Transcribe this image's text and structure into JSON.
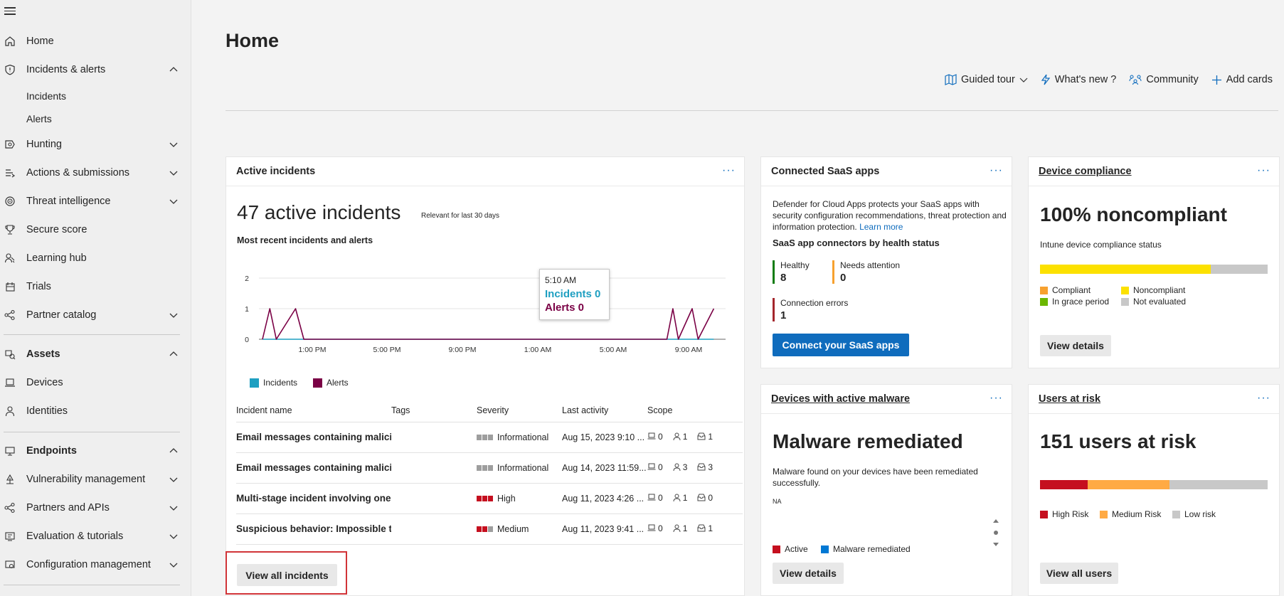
{
  "nav": {
    "home": "Home",
    "incidents_alerts": "Incidents & alerts",
    "incidents": "Incidents",
    "alerts": "Alerts",
    "hunting": "Hunting",
    "actions": "Actions & submissions",
    "threat_intel": "Threat intelligence",
    "secure_score": "Secure score",
    "learning_hub": "Learning hub",
    "trials": "Trials",
    "partner_catalog": "Partner catalog",
    "assets": "Assets",
    "devices": "Devices",
    "identities": "Identities",
    "endpoints": "Endpoints",
    "vuln_mgmt": "Vulnerability management",
    "partners_apis": "Partners and APIs",
    "eval_tutorials": "Evaluation & tutorials",
    "config_mgmt": "Configuration management"
  },
  "page": {
    "title": "Home"
  },
  "header_actions": {
    "guided_tour": "Guided tour",
    "whats_new": "What's new ?",
    "community": "Community",
    "add_cards": "Add cards"
  },
  "active_incidents": {
    "title": "Active incidents",
    "more": "···",
    "count_text": "47 active incidents",
    "relevant": "Relevant for last 30 days",
    "chart_title": "Most recent incidents and alerts",
    "tooltip": {
      "time": "5:10 AM",
      "incidents": "Incidents 0",
      "alerts": "Alerts 0"
    },
    "legend_incidents": "Incidents",
    "legend_alerts": "Alerts",
    "columns": [
      "Incident name",
      "Tags",
      "Severity",
      "Last activity",
      "Scope"
    ],
    "rows": [
      {
        "name": "Email messages containing malicio",
        "severity": "Informational",
        "last_activity": "Aug 15, 2023 9:10 ...",
        "devices": "0",
        "users": "1",
        "mailboxes": "1"
      },
      {
        "name": "Email messages containing malicio",
        "severity": "Informational",
        "last_activity": "Aug 14, 2023 11:59...",
        "devices": "0",
        "users": "3",
        "mailboxes": "3"
      },
      {
        "name": "Multi-stage incident involving one",
        "severity": "High",
        "last_activity": "Aug 11, 2023 4:26 ...",
        "devices": "0",
        "users": "1",
        "mailboxes": "0"
      },
      {
        "name": "Suspicious behavior: Impossible tr",
        "severity": "Medium",
        "last_activity": "Aug 11, 2023 9:41 ...",
        "devices": "0",
        "users": "1",
        "mailboxes": "1"
      }
    ],
    "view_all": "View all incidents"
  },
  "chart_data": {
    "type": "line",
    "title": "Most recent incidents and alerts",
    "x_tick_labels": [
      "1:00 PM",
      "5:00 PM",
      "9:00 PM",
      "1:00 AM",
      "5:00 AM",
      "9:00 AM"
    ],
    "y_ticks": [
      0,
      1,
      2
    ],
    "ylim": [
      0,
      2
    ],
    "series": [
      {
        "name": "Incidents",
        "color": "#1e9fc1",
        "values": [
          0,
          0,
          0,
          0,
          0,
          0,
          0,
          0,
          0,
          0,
          0,
          0,
          0,
          0,
          0,
          0,
          0,
          0,
          0,
          0,
          0,
          0,
          0,
          0,
          0,
          0
        ]
      },
      {
        "name": "Alerts",
        "color": "#7a0045",
        "values": [
          0,
          1,
          0,
          1,
          0,
          0,
          0,
          0,
          0,
          0,
          0,
          0,
          0,
          0,
          0,
          0,
          0,
          0,
          0,
          0,
          0,
          1,
          0,
          1,
          0,
          1
        ]
      }
    ],
    "x_positions_frac": [
      0.0,
      0.016,
      0.03,
      0.072,
      0.09,
      0.2,
      0.3,
      0.4,
      0.5,
      0.6,
      0.65,
      0.7,
      0.75,
      0.78,
      0.8,
      0.82,
      0.84,
      0.86,
      0.87,
      0.875,
      0.88,
      0.893,
      0.905,
      0.935,
      0.948,
      0.982
    ],
    "legend": "bottom-left",
    "grid": true
  },
  "saas": {
    "title": "Connected SaaS apps",
    "more": "···",
    "description": "Defender for Cloud Apps protects your SaaS apps with security configuration recommendations, threat protection and information protection.",
    "learn_more": "Learn more",
    "subtitle": "SaaS app connectors by health status",
    "healthy_label": "Healthy",
    "healthy_value": "8",
    "needs_label": "Needs attention",
    "needs_value": "0",
    "errors_label": "Connection errors",
    "errors_value": "1",
    "button": "Connect your SaaS apps",
    "colors": {
      "healthy": "#107c10",
      "needs": "#f7a12f",
      "errors": "#a4262c"
    }
  },
  "compliance": {
    "title": "Device compliance",
    "more": "···",
    "headline": "100% noncompliant",
    "subtitle": "Intune device compliance status",
    "bar": [
      {
        "label": "Noncompliant",
        "frac": 0.75,
        "color": "#fce100"
      },
      {
        "label": "Not evaluated",
        "frac": 0.25,
        "color": "#c8c8c8"
      }
    ],
    "legend": {
      "compliant": "Compliant",
      "noncompliant": "Noncompliant",
      "grace": "In grace period",
      "not_evaluated": "Not evaluated"
    },
    "legend_colors": {
      "compliant": "#f7a12f",
      "noncompliant": "#fce100",
      "grace": "#6bb700",
      "not_evaluated": "#c8c8c8"
    },
    "button": "View details"
  },
  "malware": {
    "title": "Devices with active malware",
    "more": "···",
    "headline": "Malware remediated",
    "description": "Malware found on your devices have been remediated successfully.",
    "na": "NA",
    "legend_active": "Active",
    "legend_remediated": "Malware remediated",
    "colors": {
      "active": "#c50f1f",
      "remediated": "#0078d4"
    },
    "button": "View details"
  },
  "users_risk": {
    "title": "Users at risk",
    "more": "···",
    "headline": "151 users at risk",
    "bar": [
      {
        "label": "High Risk",
        "frac": 0.21,
        "color": "#c50f1f"
      },
      {
        "label": "Medium Risk",
        "frac": 0.36,
        "color": "#ffaa44"
      },
      {
        "label": "Low risk",
        "frac": 0.43,
        "color": "#c8c8c8"
      }
    ],
    "legend_high": "High Risk",
    "legend_medium": "Medium Risk",
    "legend_low": "Low risk",
    "button": "View all users"
  }
}
